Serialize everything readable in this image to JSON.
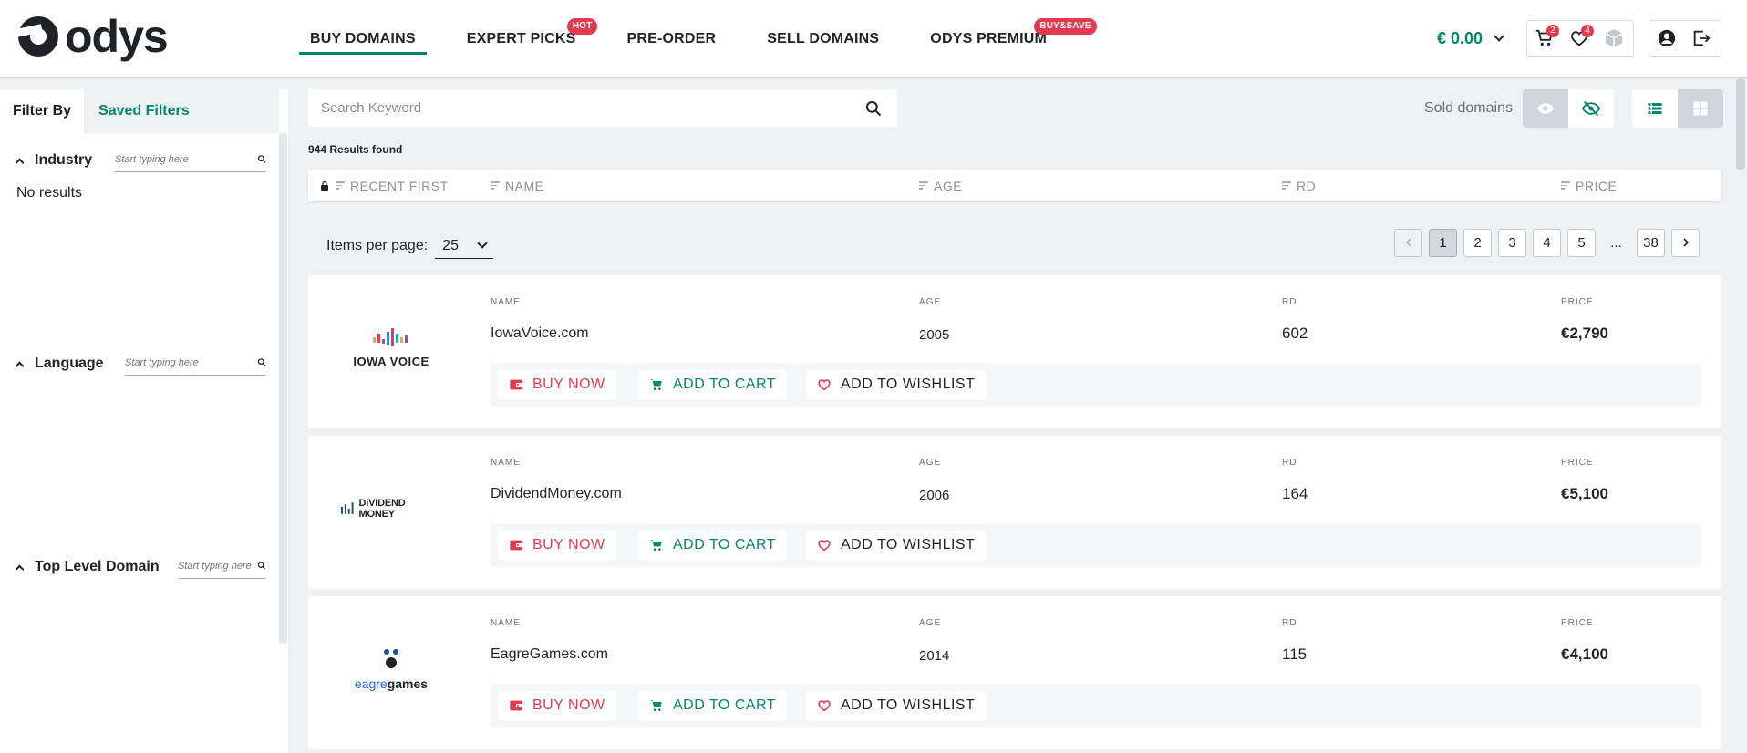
{
  "header": {
    "logo_text": "odys",
    "nav": [
      {
        "label": "BUY DOMAINS",
        "badge": ""
      },
      {
        "label": "EXPERT PICKS",
        "badge": "HOT"
      },
      {
        "label": "PRE-ORDER",
        "badge": ""
      },
      {
        "label": "SELL DOMAINS",
        "badge": ""
      },
      {
        "label": "ODYS PREMIUM",
        "badge": "BUY&SAVE"
      }
    ],
    "balance": "€ 0.00",
    "cart_count": "2",
    "wishlist_count": "4"
  },
  "sidebar": {
    "tabs": [
      "Filter By",
      "Saved Filters"
    ],
    "filters": [
      {
        "title": "Industry",
        "placeholder": "Start typing here",
        "empty_text": "No results"
      },
      {
        "title": "Language",
        "placeholder": "Start typing here"
      },
      {
        "title": "Top Level Domain",
        "placeholder": "Start typing here"
      }
    ]
  },
  "search": {
    "placeholder": "Search Keyword"
  },
  "sold_domains_label": "Sold domains",
  "results_text": "944 Results found",
  "table_headers": [
    "RECENT FIRST",
    "NAME",
    "AGE",
    "RD",
    "PRICE"
  ],
  "items_per_page": {
    "label": "Items per page:",
    "value": "25"
  },
  "pagination": {
    "pages": [
      "1",
      "2",
      "3",
      "4",
      "5"
    ],
    "ellipsis": "...",
    "last": "38",
    "current": "1"
  },
  "field_labels": {
    "name": "NAME",
    "age": "AGE",
    "rd": "RD",
    "price": "PRICE"
  },
  "actions": {
    "buy": "BUY NOW",
    "cart": "ADD TO CART",
    "wish": "ADD TO WISHLIST"
  },
  "domains": [
    {
      "name": "IowaVoice.com",
      "age": "2005",
      "rd": "602",
      "price": "€2,790",
      "logo_text": "IOWA VOICE"
    },
    {
      "name": "DividendMoney.com",
      "age": "2006",
      "rd": "164",
      "price": "€5,100",
      "logo_text": "DIVIDEND MONEY"
    },
    {
      "name": "EagreGames.com",
      "age": "2014",
      "rd": "115",
      "price": "€4,100",
      "logo_text_a": "eagre",
      "logo_text_b": "games"
    }
  ],
  "colors": {
    "accent": "#00856f",
    "danger": "#e53950",
    "background": "#eef1f4"
  }
}
